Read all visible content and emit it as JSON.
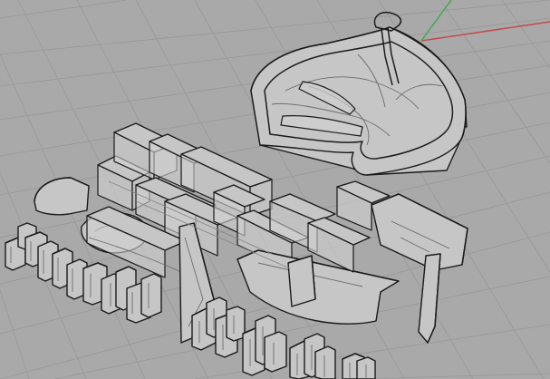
{
  "viewport": {
    "background": "#a9a9a9",
    "grid_color": "#989898",
    "axis_x_color": "#c44a4a",
    "axis_y_color": "#3fa84a",
    "model_stroke": "#1a1a1a",
    "model_fill": "#c6c6c6"
  }
}
